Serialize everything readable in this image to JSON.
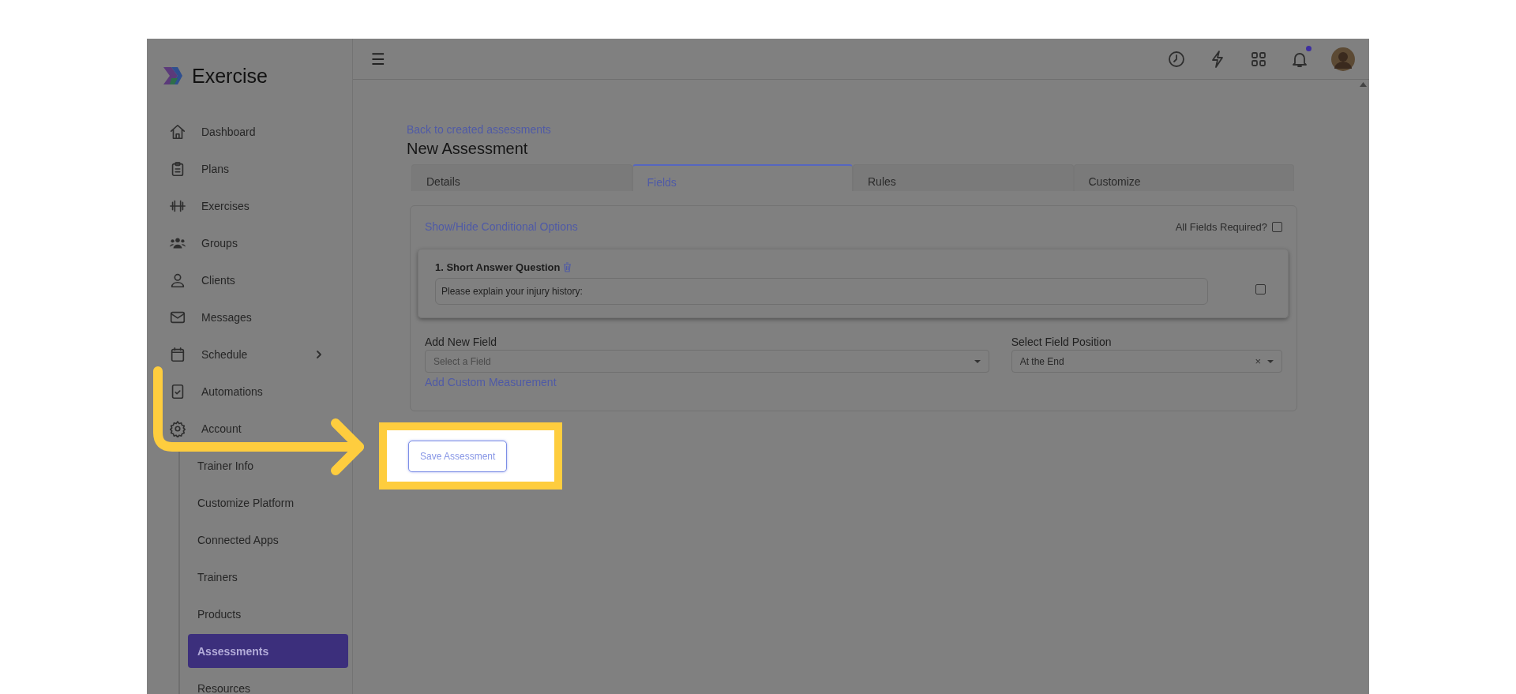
{
  "app": {
    "name": "Exercise"
  },
  "sidebar": {
    "items": [
      {
        "label": "Dashboard",
        "selected": false
      },
      {
        "label": "Plans",
        "selected": false
      },
      {
        "label": "Exercises",
        "selected": false
      },
      {
        "label": "Groups",
        "selected": false
      },
      {
        "label": "Clients",
        "selected": false
      },
      {
        "label": "Messages",
        "selected": false
      },
      {
        "label": "Schedule",
        "selected": false,
        "expandable": true
      },
      {
        "label": "Automations",
        "selected": false
      },
      {
        "label": "Account",
        "selected": false,
        "expanded": true,
        "children": [
          {
            "label": "Trainer Info",
            "selected": false
          },
          {
            "label": "Customize Platform",
            "selected": false
          },
          {
            "label": "Connected Apps",
            "selected": false
          },
          {
            "label": "Trainers",
            "selected": false
          },
          {
            "label": "Products",
            "selected": false
          },
          {
            "label": "Assessments",
            "selected": true
          },
          {
            "label": "Resources",
            "selected": false
          }
        ]
      }
    ]
  },
  "topbar": {
    "menu_glyph": "☰",
    "notifications_unread": true
  },
  "page": {
    "back_link": "Back to created assessments",
    "title": "New Assessment",
    "tabs": [
      {
        "label": "Details",
        "selected": false
      },
      {
        "label": "Fields",
        "selected": true
      },
      {
        "label": "Rules",
        "selected": false
      },
      {
        "label": "Customize",
        "selected": false
      }
    ],
    "conditional_link": "Show/Hide Conditional Options",
    "all_required": {
      "label": "All Fields Required?",
      "checked": false
    },
    "questions": [
      {
        "title": "1. Short Answer Question",
        "value": "Please explain your injury history:",
        "checked": false
      }
    ],
    "add_field": {
      "label": "Add New Field",
      "placeholder": "Select a Field"
    },
    "position": {
      "label": "Select Field Position",
      "value": "At the End",
      "clear_glyph": "×"
    },
    "custom_link": "Add Custom Measurement",
    "save_button": "Save Assessment"
  },
  "tutorial": {
    "highlight": true,
    "arrow": true
  }
}
